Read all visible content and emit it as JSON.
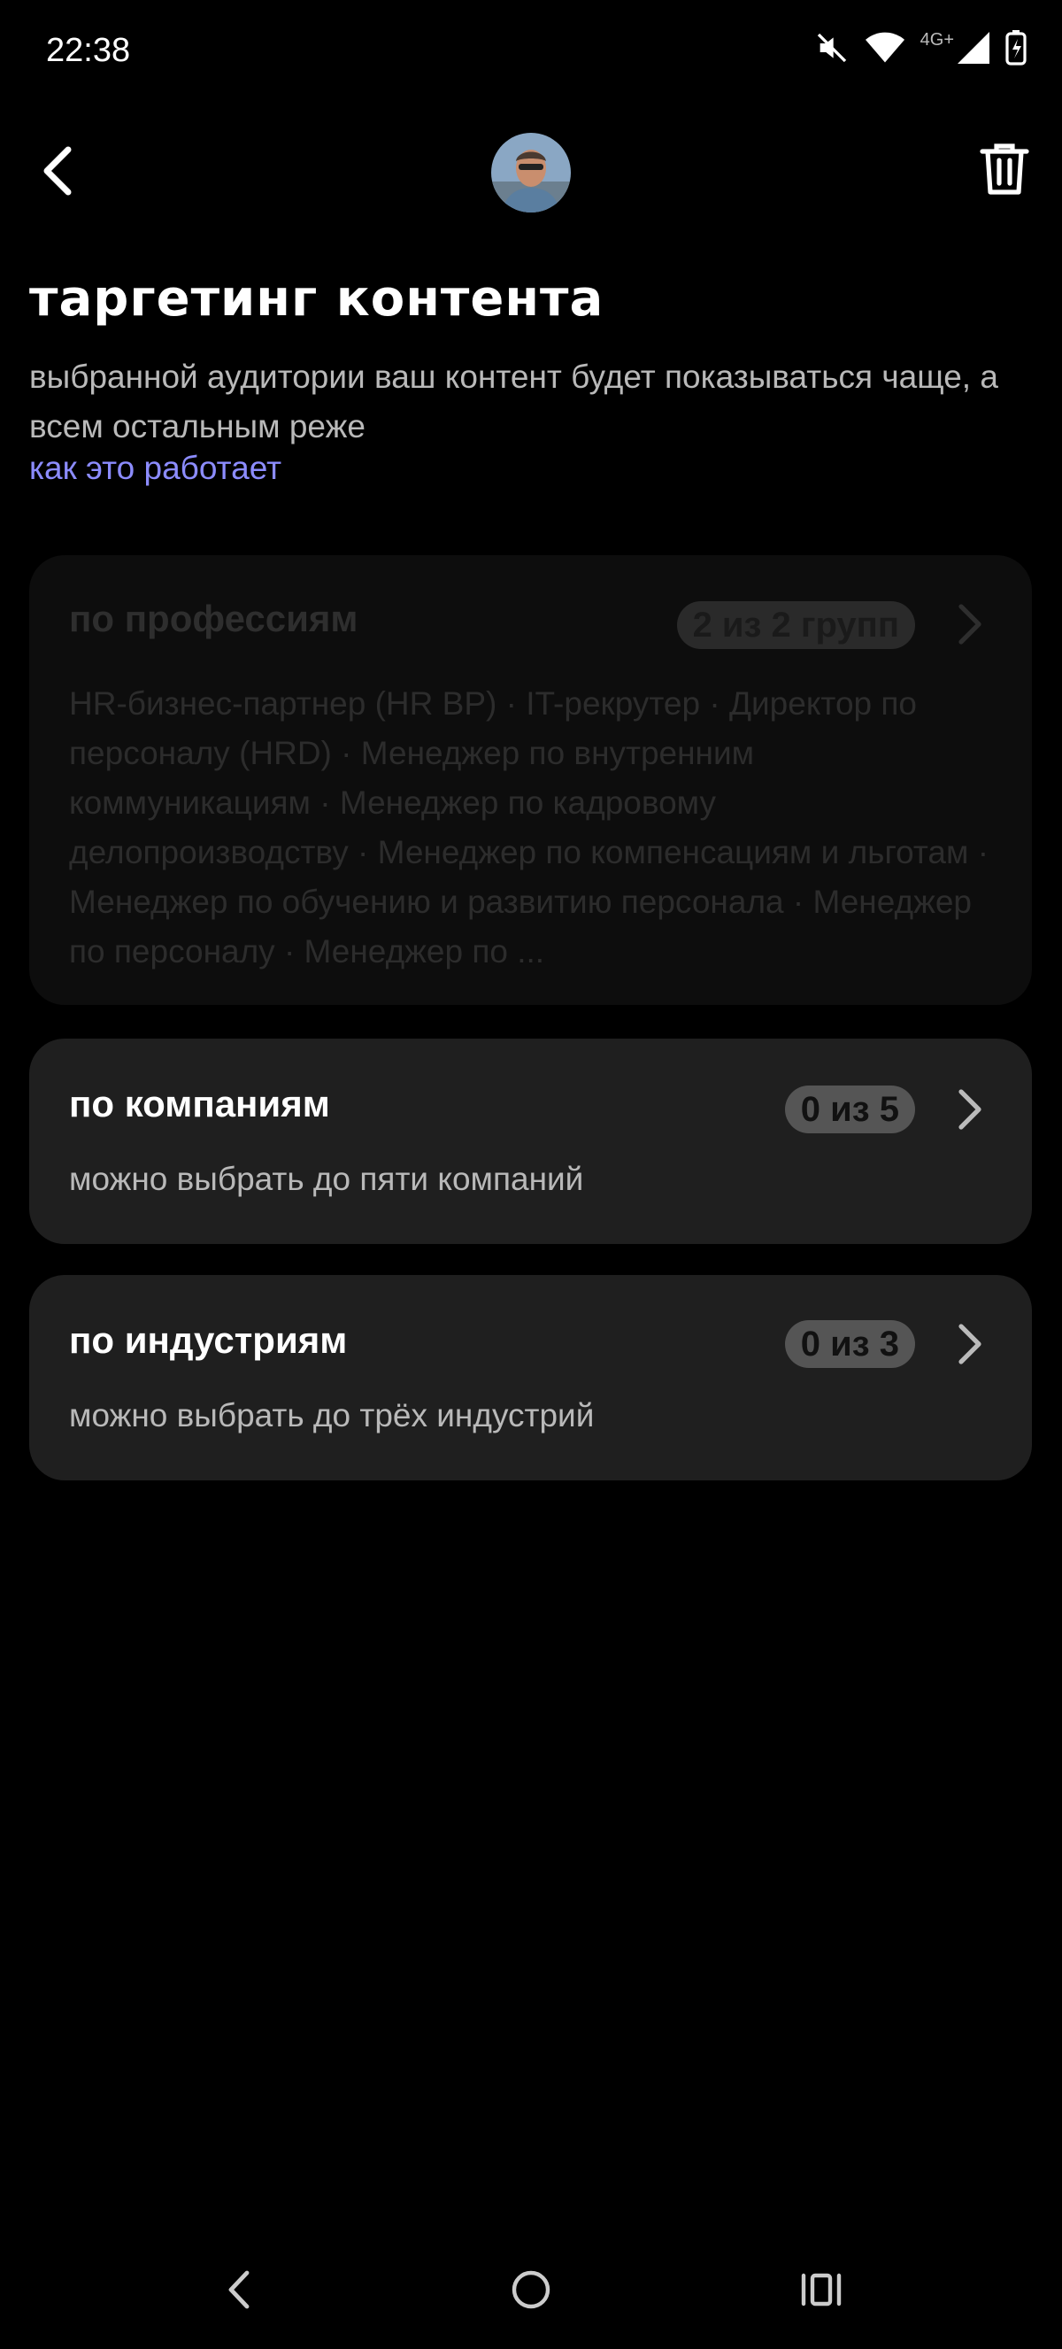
{
  "status_bar": {
    "time": "22:38",
    "network_label": "4G+",
    "icons": [
      "mute-icon",
      "wifi-icon",
      "signal-icon",
      "battery-charging-icon"
    ]
  },
  "header": {
    "back_icon": "chevron-left-icon",
    "avatar": "user-avatar",
    "delete_icon": "trash-icon"
  },
  "page": {
    "title": "таргетинг контента",
    "description": "выбранной аудитории ваш контент будет показываться чаще, а всем остальным реже",
    "link": "как это работает"
  },
  "cards": {
    "professions": {
      "title": "по профессиям",
      "badge": "2 из 2 групп",
      "list": "HR-бизнес-партнер (HR BP) · IT-рекрутер · Директор по персоналу (HRD) · Менеджер по внутренним коммуникациям · Менеджер по кадровому делопроизводству · Менеджер по компенсациям и льготам · Менеджер по обучению и развитию персонала · Менеджер по персоналу · Менеджер по ...",
      "state": "disabled"
    },
    "companies": {
      "title": "по компаниям",
      "badge": "0 из 5",
      "subtitle": "можно выбрать до пяти компаний"
    },
    "industries": {
      "title": "по индустриям",
      "badge": "0 из 3",
      "subtitle": "можно выбрать до трёх индустрий"
    }
  },
  "nav_bar": {
    "icons": [
      "nav-back-icon",
      "nav-home-icon",
      "nav-recents-icon"
    ]
  },
  "colors": {
    "background": "#000000",
    "card": "#1f1f1f",
    "link": "#8c8cff",
    "badge": "#555555"
  }
}
